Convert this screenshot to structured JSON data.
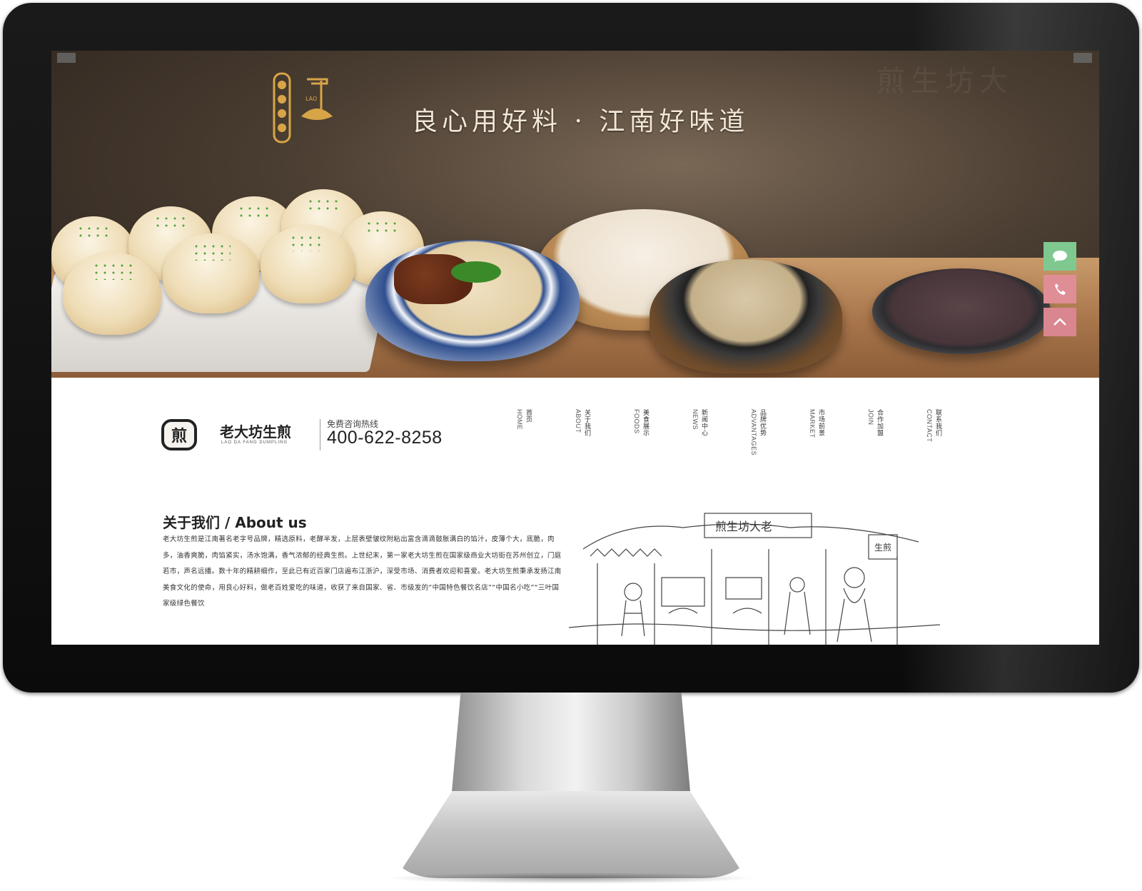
{
  "hero": {
    "slogan": "良心用好料 · 江南好味道",
    "watermark": "煎生坊大"
  },
  "side_buttons": {
    "chat_icon": "chat-icon",
    "phone_icon": "phone-icon",
    "top_icon": "chevron-up-icon"
  },
  "brand": {
    "name": "老大坊生煎",
    "sub": "LAO DA FANG DUMPLING",
    "logo_char": "煎"
  },
  "hotline": {
    "label": "免费咨询热线",
    "number": "400-622-8258"
  },
  "nav": [
    {
      "en": "HOME",
      "cn": "首页"
    },
    {
      "en": "ABOUT",
      "cn": "关于我们"
    },
    {
      "en": "FOODS",
      "cn": "美食展示"
    },
    {
      "en": "NEWS",
      "cn": "新闻中心"
    },
    {
      "en": "ADVANTAGES",
      "cn": "品牌优势"
    },
    {
      "en": "MARKET",
      "cn": "市场前景"
    },
    {
      "en": "JOIN",
      "cn": "合作加盟"
    },
    {
      "en": "CONTACT",
      "cn": "联系我们"
    }
  ],
  "about": {
    "title": "关于我们 / About us",
    "text": "老大坊生煎是江南著名老字号品牌，精选原料，老酵半发，上层表壁皱纹附粘出富含滴滴鼓胀满白的馅汁，皮薄个大，底脆，肉多，油香爽脆，肉馅紧实，汤水饱满，香气浓郁的经典生煎。上世纪末，第一家老大坊生煎在国家级商业大坊街在苏州创立，门庭若市，声名远播。数十年的精耕细作，至此已有近百家门店遍布江浙沪，深受市场、消费者欢迎和喜爱。老大坊生煎秉承发扬江南美食文化的使命，用良心好料，做老百姓爱吃的味道，收获了来自国家、省、市级发的“中国特色餐饮名店”“中国名小吃”“三叶国家级绿色餐饮"
  },
  "sketch": {
    "sign_text": "煎生坊大老",
    "sign_small": "生煎"
  }
}
